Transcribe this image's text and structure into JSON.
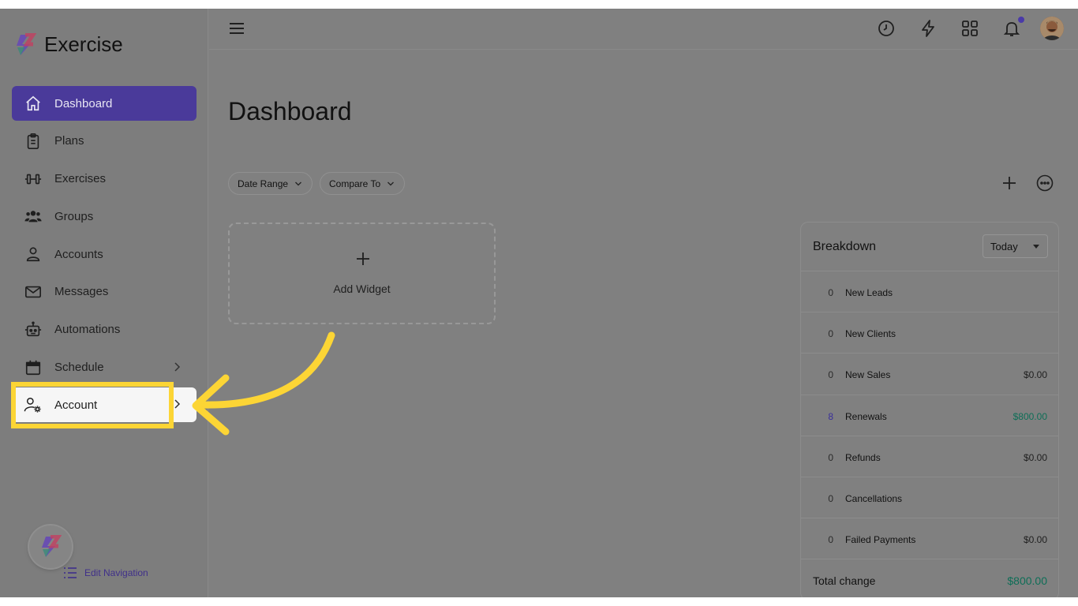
{
  "brand": {
    "name": "Exercise"
  },
  "sidebar": {
    "items": [
      {
        "label": "Dashboard",
        "icon": "home-icon",
        "active": true
      },
      {
        "label": "Plans",
        "icon": "clipboard-icon"
      },
      {
        "label": "Exercises",
        "icon": "dumbbell-icon"
      },
      {
        "label": "Groups",
        "icon": "users-icon"
      },
      {
        "label": "Accounts",
        "icon": "user-icon"
      },
      {
        "label": "Messages",
        "icon": "mail-icon"
      },
      {
        "label": "Automations",
        "icon": "robot-icon"
      },
      {
        "label": "Schedule",
        "icon": "calendar-icon",
        "has_submenu": true
      },
      {
        "label": "Account",
        "icon": "user-gear-icon",
        "has_submenu": true,
        "highlighted": true
      }
    ],
    "edit_navigation": "Edit Navigation"
  },
  "topbar": {
    "icons": [
      "menu-icon",
      "history-icon",
      "lightning-icon",
      "apps-grid-icon",
      "bell-icon",
      "avatar"
    ]
  },
  "main": {
    "title": "Dashboard",
    "filters": {
      "date_range": "Date Range",
      "compare_to": "Compare To"
    },
    "add_widget": "Add Widget"
  },
  "breakdown": {
    "title": "Breakdown",
    "period": "Today",
    "rows": [
      {
        "count": "0",
        "name": "New Leads",
        "amount": ""
      },
      {
        "count": "0",
        "name": "New Clients",
        "amount": ""
      },
      {
        "count": "0",
        "name": "New Sales",
        "amount": "$0.00"
      },
      {
        "count": "8",
        "name": "Renewals",
        "amount": "$800.00"
      },
      {
        "count": "0",
        "name": "Refunds",
        "amount": "$0.00"
      },
      {
        "count": "0",
        "name": "Cancellations",
        "amount": ""
      },
      {
        "count": "0",
        "name": "Failed Payments",
        "amount": "$0.00"
      }
    ],
    "total_label": "Total change",
    "total_amount": "$800.00"
  },
  "colors": {
    "accent": "#4a3a9a",
    "positive": "#0e6e57",
    "highlight": "#fcd535"
  }
}
